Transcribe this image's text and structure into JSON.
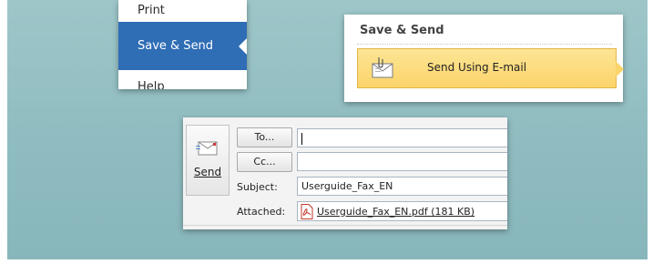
{
  "file_menu": {
    "items": [
      {
        "label": "Print"
      },
      {
        "label": "Save & Send",
        "selected": true
      },
      {
        "label": "Help"
      }
    ],
    "accent_color": "#2f6db5"
  },
  "save_send": {
    "title": "Save & Send",
    "send_email_label": "Send Using E-mail",
    "send_email_icon": "envelope-paperclip-icon",
    "highlight_color": "#fbd46a"
  },
  "compose": {
    "send_label": "Send",
    "send_icon": "envelope-send-icon",
    "to_button": "To...",
    "cc_button": "Cc...",
    "to_value": "",
    "cc_value": "",
    "subject_label": "Subject:",
    "subject_value": "Userguide_Fax_EN",
    "attached_label": "Attached:",
    "attachment_name": "Userguide_Fax_EN.pdf (181 KB)",
    "attachment_icon": "pdf-icon"
  }
}
